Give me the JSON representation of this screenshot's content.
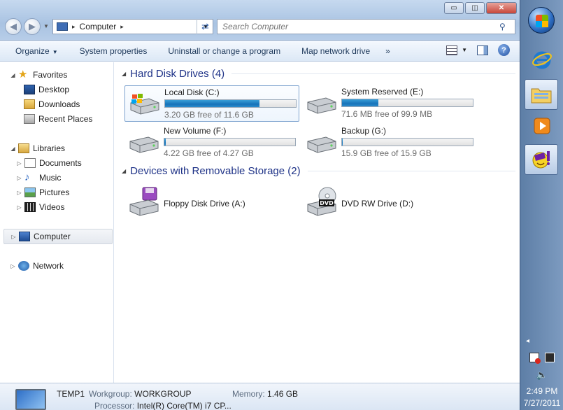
{
  "window": {
    "controls": {
      "minimize": "▭",
      "maximize": "◫",
      "close": "✕"
    },
    "address": {
      "crumb": "Computer",
      "separator": "▸"
    },
    "search": {
      "placeholder": "Search Computer"
    }
  },
  "commandbar": {
    "items": [
      "Organize",
      "System properties",
      "Uninstall or change a program",
      "Map network drive"
    ],
    "overflow": "»",
    "dropdown_arrow": "▼"
  },
  "nav": {
    "favorites": "Favorites",
    "desktop": "Desktop",
    "downloads": "Downloads",
    "recent_places": "Recent Places",
    "libraries": "Libraries",
    "documents": "Documents",
    "music": "Music",
    "pictures": "Pictures",
    "videos": "Videos",
    "computer": "Computer",
    "network": "Network"
  },
  "groups": {
    "hdd_title": "Hard Disk Drives (4)",
    "removable_title": "Devices with Removable Storage (2)"
  },
  "drives": [
    {
      "name": "Local Disk (C:)",
      "free": "3.20 GB free of 11.6 GB",
      "used_fraction": 0.72,
      "icon": "windows-drive-icon"
    },
    {
      "name": "System Reserved (E:)",
      "free": "71.6 MB free of 99.9 MB",
      "used_fraction": 0.28,
      "icon": "hard-drive-icon"
    },
    {
      "name": "New Volume (F:)",
      "free": "4.22 GB free of 4.27 GB",
      "used_fraction": 0.01,
      "icon": "hard-drive-icon"
    },
    {
      "name": "Backup (G:)",
      "free": "15.9 GB free of 15.9 GB",
      "used_fraction": 0.005,
      "icon": "hard-drive-icon"
    }
  ],
  "removable": [
    {
      "name": "Floppy Disk Drive (A:)",
      "icon": "floppy-drive-icon"
    },
    {
      "name": "DVD RW Drive (D:)",
      "icon": "dvd-drive-icon",
      "badge": "DVD"
    }
  ],
  "details": {
    "computer_name": "TEMP1",
    "workgroup_label": "Workgroup:",
    "workgroup": "WORKGROUP",
    "memory_label": "Memory:",
    "memory": "1.46 GB",
    "processor_label": "Processor:",
    "processor": "Intel(R) Core(TM) i7 CP..."
  },
  "taskbar": {
    "chevron": "◂",
    "time": "2:49 PM",
    "date": "7/27/2011"
  },
  "colors": {
    "accent": "#1e3287",
    "bar_fill": "#1f7fc4",
    "selection": "#7da2ce"
  }
}
